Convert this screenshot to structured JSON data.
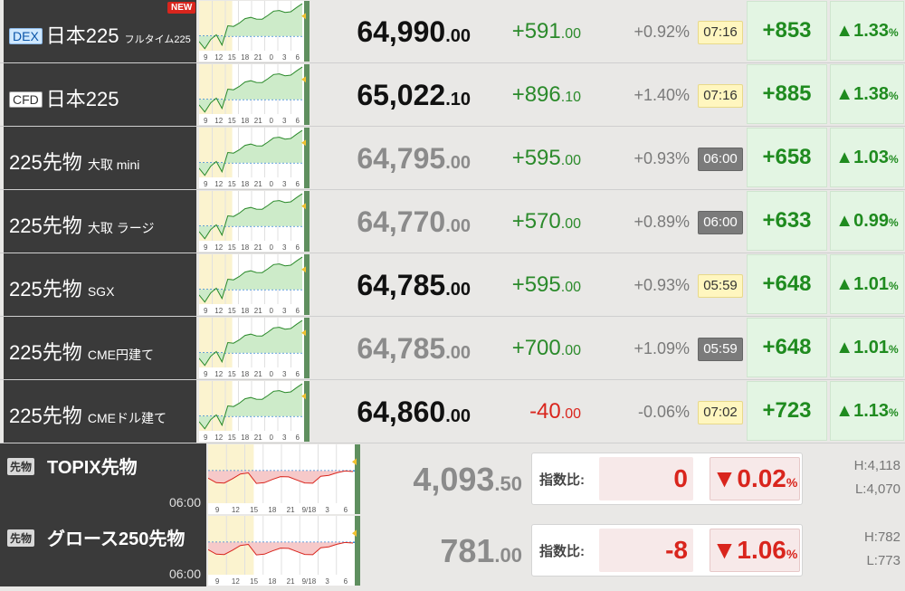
{
  "rows": [
    {
      "tag": "DEX",
      "name": "日本225",
      "sub": "フルタイム225",
      "badge": "NEW",
      "price_int": "64,990",
      "price_dec": ".00",
      "price_state": "active",
      "chg_int": "+591",
      "chg_dec": ".00",
      "chg_dir": "up",
      "pct": "+0.92%",
      "time": "07:16",
      "time_state": "live",
      "diff": "+853",
      "diff_pct": "▲1.33",
      "diff_unit": "%",
      "chart_xticks": [
        "9",
        "12",
        "15",
        "18",
        "21",
        "0",
        "3",
        "6"
      ]
    },
    {
      "tag": "CFD",
      "name": "日本225",
      "sub": "",
      "badge": "",
      "price_int": "65,022",
      "price_dec": ".10",
      "price_state": "active",
      "chg_int": "+896",
      "chg_dec": ".10",
      "chg_dir": "up",
      "pct": "+1.40%",
      "time": "07:16",
      "time_state": "live",
      "diff": "+885",
      "diff_pct": "▲1.38",
      "diff_unit": "%",
      "chart_xticks": [
        "9",
        "12",
        "15",
        "18",
        "21",
        "0",
        "3",
        "6"
      ]
    },
    {
      "tag": "",
      "name": "225先物",
      "sub": "大取 mini",
      "badge": "",
      "price_int": "64,795",
      "price_dec": ".00",
      "price_state": "stale",
      "chg_int": "+595",
      "chg_dec": ".00",
      "chg_dir": "up",
      "pct": "+0.93%",
      "time": "06:00",
      "time_state": "closed",
      "diff": "+658",
      "diff_pct": "▲1.03",
      "diff_unit": "%",
      "chart_xticks": [
        "9",
        "12",
        "15",
        "18",
        "21",
        "0",
        "3",
        "6"
      ]
    },
    {
      "tag": "",
      "name": "225先物",
      "sub": "大取 ラージ",
      "badge": "",
      "price_int": "64,770",
      "price_dec": ".00",
      "price_state": "stale",
      "chg_int": "+570",
      "chg_dec": ".00",
      "chg_dir": "up",
      "pct": "+0.89%",
      "time": "06:00",
      "time_state": "closed",
      "diff": "+633",
      "diff_pct": "▲0.99",
      "diff_unit": "%",
      "chart_xticks": [
        "9",
        "12",
        "15",
        "18",
        "21",
        "0",
        "3",
        "6"
      ]
    },
    {
      "tag": "",
      "name": "225先物",
      "sub": "SGX",
      "badge": "",
      "price_int": "64,785",
      "price_dec": ".00",
      "price_state": "active",
      "chg_int": "+595",
      "chg_dec": ".00",
      "chg_dir": "up",
      "pct": "+0.93%",
      "time": "05:59",
      "time_state": "live",
      "diff": "+648",
      "diff_pct": "▲1.01",
      "diff_unit": "%",
      "chart_xticks": [
        "9",
        "12",
        "15",
        "18",
        "21",
        "0",
        "3",
        "6"
      ]
    },
    {
      "tag": "",
      "name": "225先物",
      "sub": "CME円建て",
      "badge": "",
      "price_int": "64,785",
      "price_dec": ".00",
      "price_state": "stale",
      "chg_int": "+700",
      "chg_dec": ".00",
      "chg_dir": "up",
      "pct": "+1.09%",
      "time": "05:59",
      "time_state": "closed",
      "diff": "+648",
      "diff_pct": "▲1.01",
      "diff_unit": "%",
      "chart_xticks": [
        "9",
        "12",
        "15",
        "18",
        "21",
        "0",
        "3",
        "6"
      ]
    },
    {
      "tag": "",
      "name": "225先物",
      "sub": "CMEドル建て",
      "badge": "",
      "price_int": "64,860",
      "price_dec": ".00",
      "price_state": "active",
      "chg_int": "-40",
      "chg_dec": ".00",
      "chg_dir": "down",
      "pct": "-0.06%",
      "time": "07:02",
      "time_state": "live",
      "diff": "+723",
      "diff_pct": "▲1.13",
      "diff_unit": "%",
      "chart_xticks": [
        "9",
        "12",
        "15",
        "18",
        "21",
        "0",
        "3",
        "6"
      ]
    }
  ],
  "futures": [
    {
      "tag": "先物",
      "title": "TOPIX先物",
      "time": "06:00",
      "price_int": "4,093",
      "price_dec": ".50",
      "cmp_label": "指数比:",
      "cmp_val": "0",
      "cmp_pct": "▼0.02",
      "cmp_unit": "%",
      "high": "H:4,118",
      "low": "L:4,070",
      "chart_xticks": [
        "9",
        "12",
        "15",
        "18",
        "21",
        "9/18",
        "3",
        "6"
      ]
    },
    {
      "tag": "先物",
      "title": "グロース250先物",
      "time": "06:00",
      "price_int": "781",
      "price_dec": ".00",
      "cmp_label": "指数比:",
      "cmp_val": "-8",
      "cmp_pct": "▼1.06",
      "cmp_unit": "%",
      "high": "H:782",
      "low": "L:773",
      "chart_xticks": [
        "9",
        "12",
        "15",
        "18",
        "21",
        "9/18",
        "3",
        "6"
      ]
    }
  ],
  "colors": {
    "up": "#2b8a2b",
    "down": "#d9251d",
    "panel": "#3a3a3a",
    "live_time_bg": "#fff6bf",
    "closed_time_bg": "#7b7b7b",
    "diff_bg": "#e3f5e3"
  }
}
